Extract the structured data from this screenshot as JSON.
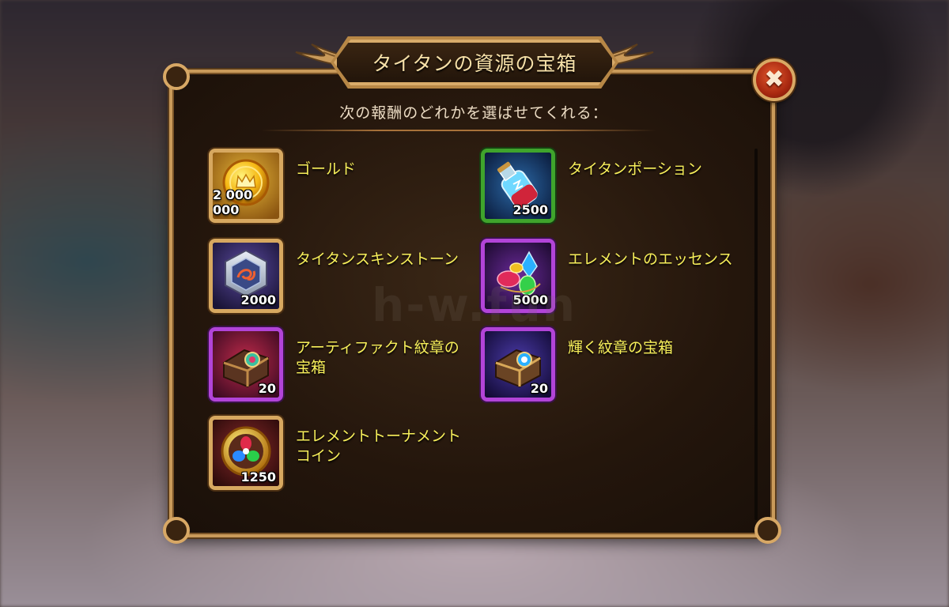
{
  "title": "タイタンの資源の宝箱",
  "subtitle": "次の報酬のどれかを選ばせてくれる：",
  "watermark": "h-w.fun",
  "close_icon": "close-x-icon",
  "colors": {
    "reward_label": "#f7ef5a",
    "frame_gold": "#d7a860",
    "frame_green": "#3fa42c",
    "frame_purple": "#b244d8"
  },
  "rewards": [
    {
      "label": "ゴールド",
      "quantity": "2 000 000",
      "icon": "gold-coin-icon",
      "rarity": "gold"
    },
    {
      "label": "タイタンポーション",
      "quantity": "2500",
      "icon": "titan-potion-icon",
      "rarity": "green"
    },
    {
      "label": "タイタンスキンストーン",
      "quantity": "2000",
      "icon": "titan-skin-stone-icon",
      "rarity": "gold"
    },
    {
      "label": "エレメントのエッセンス",
      "quantity": "5000",
      "icon": "elemental-essence-icon",
      "rarity": "purple"
    },
    {
      "label": "アーティファクト紋章の宝箱",
      "quantity": "20",
      "icon": "artifact-emblem-chest-icon",
      "rarity": "purple"
    },
    {
      "label": "輝く紋章の宝箱",
      "quantity": "20",
      "icon": "shining-emblem-chest-icon",
      "rarity": "purple"
    },
    {
      "label": "エレメントトーナメントコイン",
      "quantity": "1250",
      "icon": "elemental-tournament-coin-icon",
      "rarity": "gold"
    }
  ]
}
